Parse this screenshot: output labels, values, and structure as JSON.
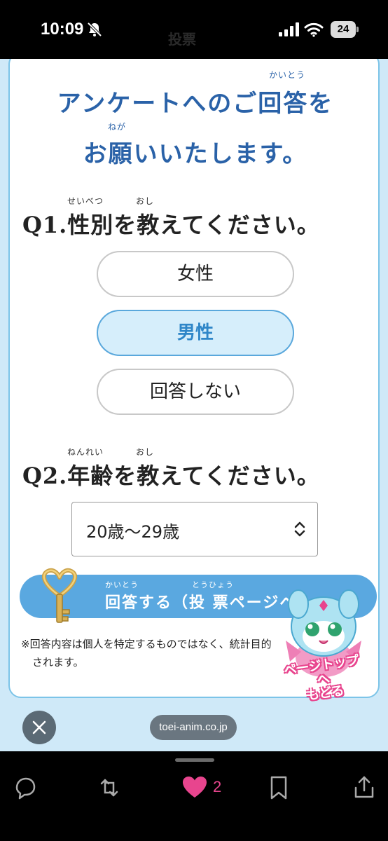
{
  "status_bar": {
    "time": "10:09",
    "battery": "24"
  },
  "ghost_title": "投票",
  "survey": {
    "title_line1": "アンケートへのご回答を",
    "title_line1_ruby": "かいとう",
    "title_line2": "お願いいたします。",
    "title_line2_ruby": "ねが",
    "q1": {
      "text": "Q1.性別を教えてください。",
      "ruby_seibetsu": "せいべつ",
      "ruby_oshi": "おし"
    },
    "options": [
      {
        "label": "女性",
        "selected": false
      },
      {
        "label": "男性",
        "selected": true
      },
      {
        "label": "回答しない",
        "selected": false
      }
    ],
    "q2": {
      "text": "Q2.年齢を教えてください。",
      "ruby_nenrei": "ねんれい",
      "ruby_oshi": "おし"
    },
    "age_select": {
      "value": "20歳～29歳"
    },
    "submit": {
      "label": "回答する（投 票ページへ）",
      "ruby1": "かいとう",
      "ruby2": "とうひょう"
    },
    "note_line1": "※回答内容は個人を特定するものではなく、統計目的",
    "note_line2": "されます。",
    "page_top_button": {
      "line1": "ページトップへ",
      "line2": "もどる"
    }
  },
  "browser": {
    "url": "toei-anim.co.jp"
  },
  "tweet_actions": {
    "like_count": "2"
  },
  "colors": {
    "accent": "#2a62a8",
    "button_blue": "#5aa8e0",
    "like_pink": "#e8458e",
    "page_bg": "#cfe9f8"
  }
}
